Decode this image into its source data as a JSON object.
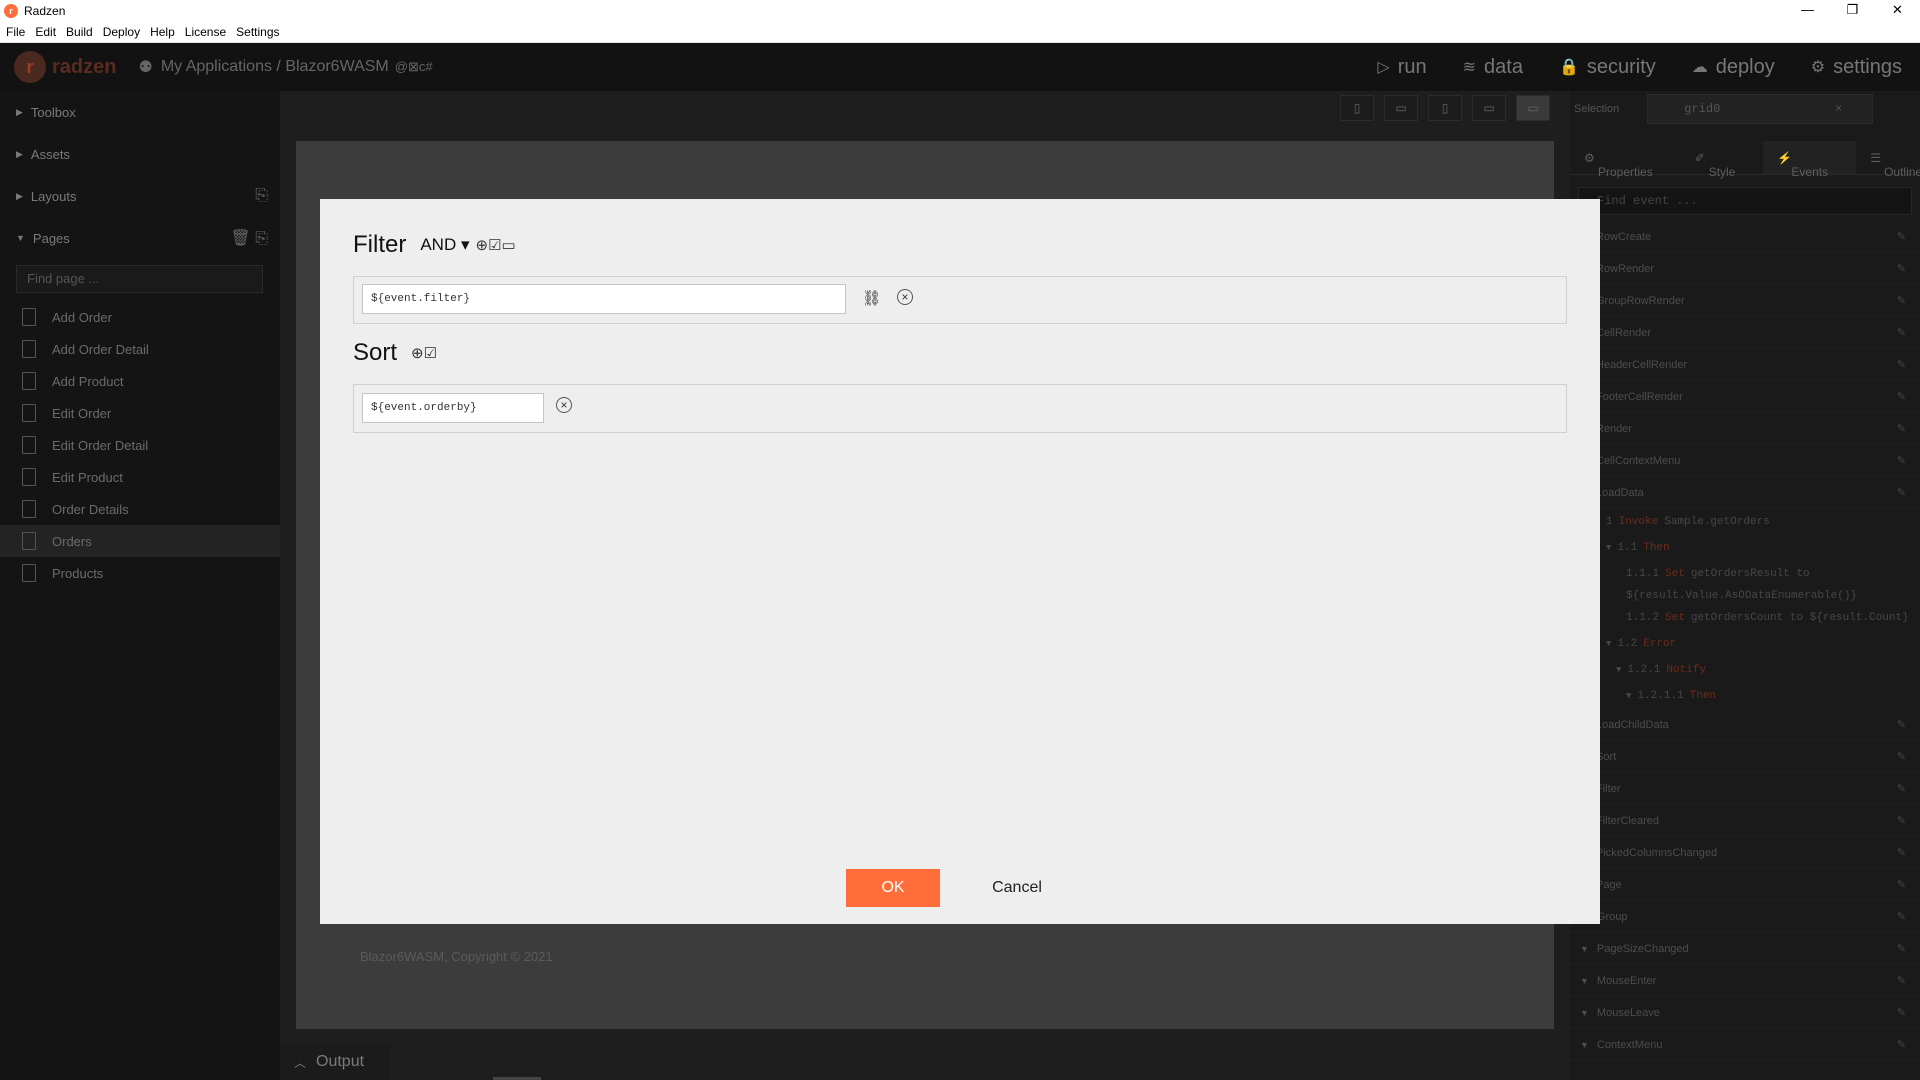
{
  "window": {
    "title": "Radzen",
    "icon_letter": "r",
    "minimize": "—",
    "restore": "❐",
    "close": "✕"
  },
  "menu": [
    "File",
    "Edit",
    "Build",
    "Deploy",
    "Help",
    "License",
    "Settings"
  ],
  "header": {
    "logo_letter": "r",
    "logo_text": "radzen",
    "breadcrumb": "My Applications / Blazor6WASM",
    "breadcrumb_badges": "@⊠c#",
    "actions": [
      {
        "icon": "▷",
        "label": "run"
      },
      {
        "icon": "≋",
        "label": "data"
      },
      {
        "icon": "🔒",
        "label": "security"
      },
      {
        "icon": "☁",
        "label": "deploy"
      },
      {
        "icon": "⚙",
        "label": "settings"
      }
    ]
  },
  "sidebar": {
    "sections": [
      "Toolbox",
      "Assets",
      "Layouts",
      "Pages"
    ],
    "find_page_placeholder": "Find page ...",
    "pages": [
      "Add Order",
      "Add Order Detail",
      "Add Product",
      "Edit Order",
      "Edit Order Detail",
      "Edit Product",
      "Order Details",
      "Orders",
      "Products"
    ],
    "active_page": "Orders"
  },
  "canvas": {
    "footer": "Blazor6WASM, Copyright © 2021",
    "devices": [
      "▯",
      "▭",
      "▯",
      "▭",
      "▭"
    ]
  },
  "output": {
    "label": "Output"
  },
  "right_panel": {
    "selection_label": "Selection",
    "selection_value": "grid0",
    "selection_clear": "×",
    "tabs": [
      "Properties",
      "Style",
      "Events",
      "Outline"
    ],
    "active_tab": "Events",
    "find_event_placeholder": "Find event ...",
    "events_top": [
      "RowCreate",
      "RowRender",
      "GroupRowRender",
      "CellRender",
      "HeaderCellRender",
      "FooterCellRender",
      "Render",
      "CellContextMenu",
      "LoadData"
    ],
    "code": [
      {
        "num": "1",
        "kw": "Invoke",
        "text": "Sample.getOrders"
      },
      {
        "num": "1.1",
        "kw": "Then",
        "text": ""
      },
      {
        "num": "1.1.1",
        "kw": "Set",
        "text": "getOrdersResult to"
      },
      {
        "num": "",
        "kw": "",
        "text": "${result.Value.AsODataEnumerable()}"
      },
      {
        "num": "1.1.2",
        "kw": "Set",
        "text": "getOrdersCount to ${result.Count}"
      },
      {
        "num": "1.2",
        "kw": "Error",
        "text": ""
      },
      {
        "num": "1.2.1",
        "kw": "Notify",
        "text": ""
      },
      {
        "num": "1.2.1.1",
        "kw": "Then",
        "text": ""
      }
    ],
    "events_mid": [
      "LoadChildData",
      "Sort",
      "Filter",
      "FilterCleared",
      "PickedColumnsChanged",
      "Page"
    ],
    "events_bottom": [
      "Group",
      "PageSizeChanged",
      "MouseEnter",
      "MouseLeave",
      "ContextMenu"
    ],
    "edit_icon": "✎"
  },
  "dialog": {
    "filter_title": "Filter",
    "filter_operator": "AND ▾",
    "filter_icons": "⊕☑▭",
    "filter_value": "${event.filter}",
    "link_icon": "⛓",
    "remove_icon": "×",
    "sort_title": "Sort",
    "sort_icons": "⊕☑",
    "sort_value": "${event.orderby}",
    "ok_label": "OK",
    "cancel_label": "Cancel"
  }
}
